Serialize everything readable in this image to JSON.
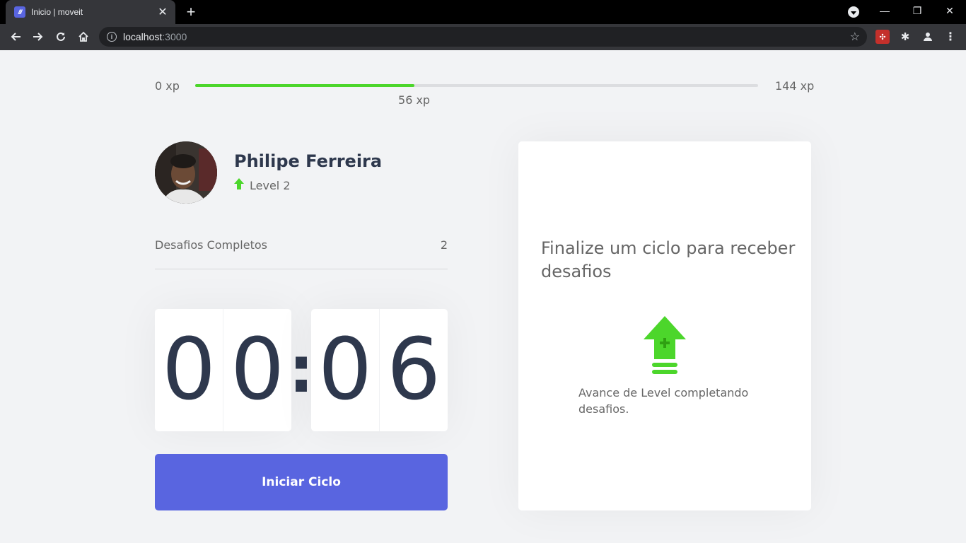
{
  "browser": {
    "tab_title": "Inicio | moveit",
    "favicon_text": "///",
    "url_host": "localhost",
    "url_port": ":3000"
  },
  "xp": {
    "min_label": "0 xp",
    "max_label": "144 xp",
    "current_label": "56 xp",
    "current": 56,
    "max": 144,
    "bar_color": "#4cd62b"
  },
  "profile": {
    "name": "Philipe Ferreira",
    "level_label": "Level 2",
    "level_icon": "level-up-arrow-icon"
  },
  "challenges_completed": {
    "label": "Desafios Completos",
    "value": "2"
  },
  "countdown": {
    "minute_left": "0",
    "minute_right": "0",
    "second_left": "0",
    "second_right": "6"
  },
  "actions": {
    "start_cycle": "Iniciar Ciclo"
  },
  "challenge_box": {
    "title": "Finalize um ciclo para receber desafios",
    "description": "Avance de Level completando desafios.",
    "icon": "level-up-icon"
  },
  "colors": {
    "primary": "#5965e0",
    "green": "#4cd62b",
    "title": "#2e384d",
    "text": "#666666",
    "background": "#f2f3f5"
  }
}
